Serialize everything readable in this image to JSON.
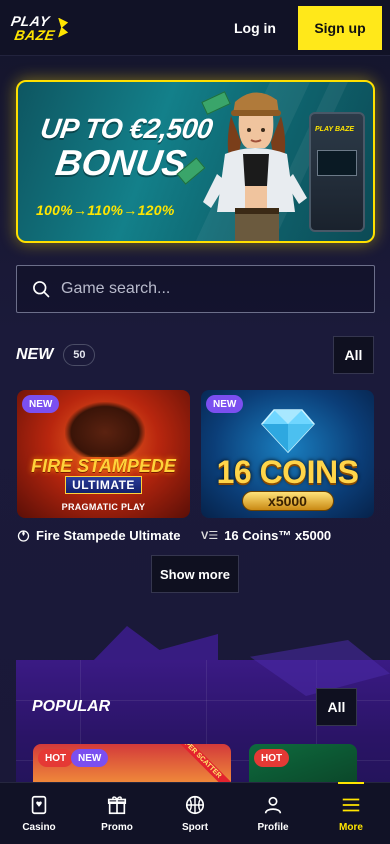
{
  "header": {
    "logo_line1": "PLAY",
    "logo_line2": "BAZE",
    "login_label": "Log in",
    "signup_label": "Sign up"
  },
  "banner": {
    "line1": "UP TO €2,500",
    "line2": "BONUS",
    "tiers": "100%→110%→120%",
    "slot_brand": "PLAY BAZE"
  },
  "search": {
    "placeholder": "Game search..."
  },
  "new_section": {
    "title": "NEW",
    "count": "50",
    "all_label": "All",
    "games": [
      {
        "badge": "NEW",
        "art_title1": "FIRE STAMPEDE",
        "art_title2": "ULTIMATE",
        "art_provider": "PRAGMATIC PLAY",
        "name": "Fire Stampede Ultimate",
        "provider_icon": "pragmatic-play-icon"
      },
      {
        "badge": "NEW",
        "art_title1": "16 COINS",
        "art_title2": "x5000",
        "name": "16 Coins™ x5000",
        "provider_icon": "v-provider-icon"
      }
    ],
    "show_more_label": "Show more"
  },
  "popular_section": {
    "title": "POPULAR",
    "all_label": "All",
    "games": [
      {
        "badges": [
          "HOT",
          "NEW"
        ],
        "corner_label": "SUPER SCATTER"
      },
      {
        "badges": [
          "HOT"
        ]
      }
    ]
  },
  "bottom_nav": {
    "items": [
      {
        "label": "Casino",
        "icon": "casino-card-icon"
      },
      {
        "label": "Promo",
        "icon": "gift-icon"
      },
      {
        "label": "Sport",
        "icon": "basketball-icon"
      },
      {
        "label": "Profile",
        "icon": "profile-icon"
      },
      {
        "label": "More",
        "icon": "menu-icon",
        "active": true
      }
    ]
  },
  "colors": {
    "accent": "#ffe81a",
    "badge_new": "#7b4ff0",
    "badge_hot": "#e53935",
    "background": "#1b1a3a"
  }
}
